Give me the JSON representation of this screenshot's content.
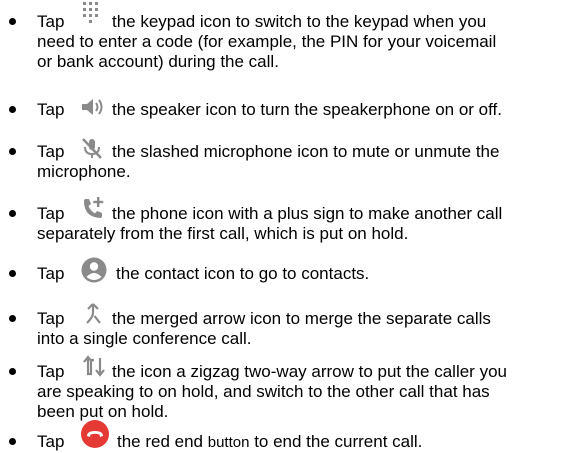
{
  "items": [
    {
      "tap": "Tap",
      "icon": "keypad-icon",
      "line1": "the keypad icon to switch to the keypad when you",
      "line2": "need to enter a code (for example, the PIN for your voicemail",
      "line3": "or bank account) during the call."
    },
    {
      "tap": "Tap",
      "icon": "speaker-icon",
      "line1": "the speaker icon to turn the speakerphone on or off."
    },
    {
      "tap": "Tap",
      "icon": "mute-icon",
      "line1": "the slashed microphone icon to mute or unmute the",
      "line2": "microphone."
    },
    {
      "tap": "Tap",
      "icon": "add-call-icon",
      "line1": "the phone icon with a plus sign to make another call",
      "line2": "separately from the first call, which is put on hold."
    },
    {
      "tap": "Tap",
      "icon": "contact-icon",
      "line1": "the contact icon to go to contacts."
    },
    {
      "tap": "Tap",
      "icon": "merge-icon",
      "line1": "the merged arrow icon to merge the separate calls",
      "line2": "into a single conference call."
    },
    {
      "tap": "Tap",
      "icon": "swap-icon",
      "line1": "the icon a zigzag two-way arrow to put the caller you",
      "line2": "are speaking to on hold, and switch to the other call that has",
      "line3": "been put on hold."
    },
    {
      "tap": "Tap",
      "icon": "end-call-icon",
      "line1a": "the red end ",
      "line1b": "button",
      "line1c": " to end the current call."
    }
  ],
  "colors": {
    "icon_gray": "#8a8a8a",
    "end_call_red": "#e53935"
  }
}
